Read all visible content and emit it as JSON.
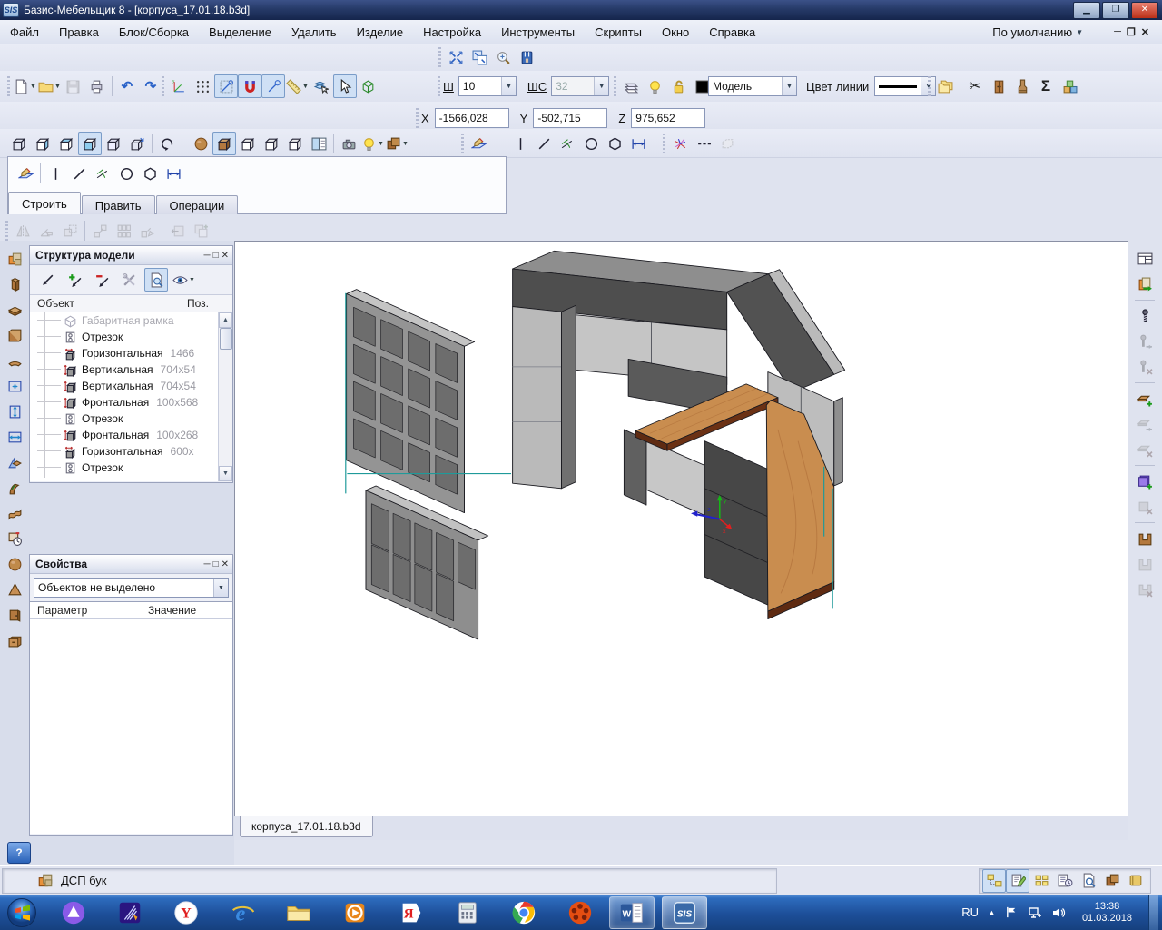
{
  "window": {
    "title": "Базис-Мебельщик 8 - [корпуса_17.01.18.b3d]",
    "logo": "SIS"
  },
  "menubar": {
    "items": [
      "Файл",
      "Правка",
      "Блок/Сборка",
      "Выделение",
      "Удалить",
      "Изделие",
      "Настройка",
      "Инструменты",
      "Скрипты",
      "Окно",
      "Справка"
    ],
    "profile": "По умолчанию"
  },
  "fields": {
    "sh_label": "Ш",
    "sh_value": "10",
    "shs_label": "ШС",
    "shs_value": "32",
    "model_value": "Модель",
    "line_color_label": "Цвет линии",
    "x_label": "X",
    "x_value": "-1566,028",
    "y_label": "Y",
    "y_value": "-502,715",
    "z_label": "Z",
    "z_value": "975,652"
  },
  "build_tabs": [
    {
      "label": "Строить",
      "active": true
    },
    {
      "label": "Править",
      "active": false
    },
    {
      "label": "Операции",
      "active": false
    }
  ],
  "structure_panel": {
    "title": "Структура модели",
    "columns": [
      "Объект",
      "Поз."
    ],
    "items": [
      {
        "kind": "frame",
        "label": "Габаритная рамка",
        "dim": "",
        "muted": true
      },
      {
        "kind": "segment",
        "label": "Отрезок",
        "dim": ""
      },
      {
        "kind": "panelh",
        "label": "Горизонтальная",
        "dim": "1466"
      },
      {
        "kind": "panelv",
        "label": "Вертикальная",
        "dim": "704x54"
      },
      {
        "kind": "panelv",
        "label": "Вертикальная",
        "dim": "704x54"
      },
      {
        "kind": "panelf",
        "label": "Фронтальная",
        "dim": "100x568"
      },
      {
        "kind": "segment",
        "label": "Отрезок",
        "dim": ""
      },
      {
        "kind": "panelf",
        "label": "Фронтальная",
        "dim": "100x268"
      },
      {
        "kind": "panelh",
        "label": "Горизонтальная",
        "dim": "600x"
      },
      {
        "kind": "segment",
        "label": "Отрезок",
        "dim": ""
      }
    ]
  },
  "properties_panel": {
    "title": "Свойства",
    "selection": "Объектов не выделено",
    "columns": [
      "Параметр",
      "Значение"
    ]
  },
  "document_tab": "корпуса_17.01.18.b3d",
  "status": {
    "material": "ДСП бук",
    "help": "?"
  },
  "taskbar": {
    "lang": "RU",
    "time": "13:38",
    "date": "01.03.2018",
    "apps": [
      {
        "name": "alice"
      },
      {
        "name": "pen-tool"
      },
      {
        "name": "yandex-browser"
      },
      {
        "name": "internet-explorer"
      },
      {
        "name": "file-explorer"
      },
      {
        "name": "media-player"
      },
      {
        "name": "yandex"
      },
      {
        "name": "calculator"
      },
      {
        "name": "chrome"
      },
      {
        "name": "movie-app"
      },
      {
        "name": "word",
        "active": true
      },
      {
        "name": "bazis",
        "active": true,
        "current": true
      }
    ]
  },
  "icons": {
    "zoom_tools": [
      {
        "name": "fit-screen",
        "kind": "fit"
      },
      {
        "name": "fit-all-windows",
        "kind": "fitall"
      },
      {
        "name": "zoom-lens",
        "kind": "lens"
      },
      {
        "name": "redraw-brush",
        "kind": "brushblk"
      }
    ],
    "file_tools": [
      {
        "name": "new-file",
        "kind": "doc",
        "arrow": true
      },
      {
        "name": "open-file",
        "kind": "folder",
        "arrow": true
      },
      {
        "name": "save-file",
        "kind": "floppy",
        "disabled": true
      },
      {
        "name": "print",
        "kind": "printer"
      },
      {
        "kind": "sep"
      },
      {
        "name": "undo",
        "kind": "undo"
      },
      {
        "name": "redo",
        "kind": "redo"
      }
    ],
    "snap_tools": [
      {
        "name": "coordinate-axes",
        "kind": "axes"
      },
      {
        "name": "grid",
        "kind": "griddots"
      },
      {
        "name": "snap-corner",
        "kind": "snapcorner",
        "pressed": true
      },
      {
        "name": "snap-magnet",
        "kind": "magnet",
        "pressed": true
      },
      {
        "name": "snap-line",
        "kind": "snapline",
        "pressed": true
      },
      {
        "name": "ruler",
        "kind": "ruler",
        "arrow": true
      },
      {
        "name": "select-layers",
        "kind": "layerscursor"
      },
      {
        "name": "select-cursor",
        "kind": "cursor",
        "pressed": true
      },
      {
        "name": "box-3d",
        "kind": "box3d"
      }
    ],
    "display_tools": [
      {
        "name": "layers",
        "kind": "layers"
      },
      {
        "name": "light-toggle",
        "kind": "bulb"
      },
      {
        "name": "lock-toggle",
        "kind": "lockopen"
      },
      {
        "name": "current-color",
        "kind": "swatchblack"
      }
    ],
    "object_tools": [
      {
        "name": "copy-objects",
        "kind": "foldercopy"
      },
      {
        "kind": "sep"
      },
      {
        "name": "cut-objects",
        "kind": "scissors"
      },
      {
        "name": "cabinet-tool",
        "kind": "cabinet"
      },
      {
        "name": "drill-tool",
        "kind": "drill"
      },
      {
        "name": "sum-tool",
        "kind": "sigma"
      },
      {
        "name": "assembly-blocks",
        "kind": "blocks"
      }
    ],
    "view_tools": [
      {
        "name": "view-wireframe",
        "kind": "cubewire"
      },
      {
        "name": "view-left",
        "kind": "cubeL"
      },
      {
        "name": "view-back",
        "kind": "cubeB"
      },
      {
        "name": "view-front",
        "kind": "cubeF",
        "pressed": true
      },
      {
        "name": "view-iso",
        "kind": "cubeI"
      },
      {
        "name": "view-rotate-to",
        "kind": "cubeA"
      },
      {
        "kind": "sep"
      },
      {
        "name": "rotate-view",
        "kind": "rotatearc"
      }
    ],
    "render_tools": [
      {
        "name": "render-sphere",
        "kind": "spherewood"
      },
      {
        "name": "render-textured",
        "kind": "cubewood",
        "pressed": true
      },
      {
        "name": "render-white-1",
        "kind": "cubewhite"
      },
      {
        "name": "render-white-2",
        "kind": "cubewhite"
      },
      {
        "name": "render-white-3",
        "kind": "cubewhite"
      },
      {
        "name": "split-view",
        "kind": "splitview"
      },
      {
        "kind": "sep"
      },
      {
        "name": "snapshot-camera",
        "kind": "camera"
      },
      {
        "name": "scene-light",
        "kind": "bulb",
        "arrow": true
      },
      {
        "name": "scene-materials",
        "kind": "cubesbrown",
        "arrow": true
      }
    ],
    "plane_tool": [
      {
        "name": "draw-on-plane",
        "kind": "drawplane"
      }
    ],
    "draw_tools": [
      {
        "name": "draw-vertical-line",
        "kind": "vline"
      },
      {
        "name": "draw-line",
        "kind": "dline"
      },
      {
        "name": "draw-parallel",
        "kind": "parallel"
      },
      {
        "name": "draw-circle",
        "kind": "circleicon"
      },
      {
        "name": "draw-polygon",
        "kind": "polygon"
      },
      {
        "name": "draw-dimension",
        "kind": "dimension"
      }
    ],
    "edit_tools": [
      {
        "name": "trim-burst",
        "kind": "burst"
      },
      {
        "name": "dashed-line",
        "kind": "dashed"
      },
      {
        "name": "ghost-box",
        "kind": "boxghost",
        "disabled": true
      }
    ],
    "modify_tools": [
      {
        "name": "mirror",
        "kind": "mirror",
        "disabled": true
      },
      {
        "name": "rotate-by-angle",
        "kind": "rotangle",
        "disabled": true
      },
      {
        "name": "scale",
        "kind": "scalecopy",
        "disabled": true
      },
      {
        "kind": "sep"
      },
      {
        "name": "copy-move",
        "kind": "copyup",
        "disabled": true
      },
      {
        "name": "copy-grid",
        "kind": "copygrid",
        "disabled": true
      },
      {
        "name": "copy-diagonal",
        "kind": "copydiag",
        "disabled": true
      },
      {
        "kind": "sep"
      },
      {
        "name": "paste-back",
        "kind": "pasteL",
        "disabled": true
      },
      {
        "name": "paste-add",
        "kind": "pastePlus",
        "disabled": true
      }
    ],
    "panel_draw_tools": [
      {
        "name": "draw-on-plane",
        "kind": "drawplane"
      },
      {
        "kind": "sep"
      },
      {
        "name": "draw-vertical-line",
        "kind": "vline"
      },
      {
        "name": "draw-line",
        "kind": "dline"
      },
      {
        "name": "draw-parallel",
        "kind": "parallel"
      },
      {
        "name": "draw-circle",
        "kind": "circleicon"
      },
      {
        "name": "draw-polygon",
        "kind": "polygon"
      },
      {
        "name": "draw-dimension",
        "kind": "dimension"
      }
    ],
    "left_tools": [
      {
        "name": "material-swatches",
        "kind": "matswatch"
      },
      {
        "name": "vertical-panel",
        "kind": "panelv"
      },
      {
        "name": "horizontal-panel",
        "kind": "panelh"
      },
      {
        "name": "frontal-panel",
        "kind": "panelf"
      },
      {
        "name": "curved-panel",
        "kind": "panelarc"
      },
      {
        "name": "frame-dimensions",
        "kind": "framearrows"
      },
      {
        "name": "vertical-dimension",
        "kind": "varrows"
      },
      {
        "name": "horizontal-dimension",
        "kind": "harrows"
      },
      {
        "name": "panel-on-plane",
        "kind": "panelplane"
      },
      {
        "name": "bent-panel",
        "kind": "panelbent"
      },
      {
        "name": "wavy-panel",
        "kind": "panelwavy"
      },
      {
        "name": "panel-rotation",
        "kind": "panelclock"
      },
      {
        "name": "sphere-solid",
        "kind": "spherewood"
      },
      {
        "name": "pyramid-solid",
        "kind": "cone"
      },
      {
        "name": "door-panel",
        "kind": "door"
      },
      {
        "name": "drawer-box",
        "kind": "drawer"
      }
    ],
    "right_tools": [
      {
        "name": "window-table",
        "kind": "wintable"
      },
      {
        "name": "material-transfer",
        "kind": "matarrow"
      },
      {
        "kind": "sep"
      },
      {
        "name": "screw-add",
        "kind": "screw"
      },
      {
        "name": "screw-move",
        "kind": "screwmove",
        "disabled": true
      },
      {
        "name": "screw-delete",
        "kind": "screwdel",
        "disabled": true
      },
      {
        "kind": "sep"
      },
      {
        "name": "edgeband-add",
        "kind": "bandadd"
      },
      {
        "name": "edgeband-move",
        "kind": "bandmove",
        "disabled": true
      },
      {
        "name": "edgeband-delete",
        "kind": "banddel",
        "disabled": true
      },
      {
        "kind": "sep"
      },
      {
        "name": "panel-add",
        "kind": "paneladd"
      },
      {
        "name": "panel-delete",
        "kind": "paneldel",
        "disabled": true
      },
      {
        "kind": "sep"
      },
      {
        "name": "groove-add",
        "kind": "groove"
      },
      {
        "name": "groove-move",
        "kind": "groove2",
        "disabled": true
      },
      {
        "name": "groove-delete",
        "kind": "groovedel",
        "disabled": true
      }
    ],
    "structure_tools": [
      {
        "name": "pick-object",
        "kind": "arrowline"
      },
      {
        "name": "add-to-selection",
        "kind": "addplus"
      },
      {
        "name": "remove-from-selection",
        "kind": "delminus"
      },
      {
        "name": "selection-settings",
        "kind": "tools"
      },
      {
        "name": "preview-object",
        "kind": "previewdoc",
        "pressed": true
      },
      {
        "name": "visibility",
        "kind": "eyedrop",
        "arrow": true
      }
    ],
    "status_tools": [
      {
        "name": "structure-view",
        "kind": "treenotes",
        "pressed": true
      },
      {
        "name": "edit-mode",
        "kind": "editpencil",
        "pressed": true
      },
      {
        "name": "cells-view",
        "kind": "cellsgrid"
      },
      {
        "name": "parameters-list",
        "kind": "listclock"
      },
      {
        "name": "search-preview",
        "kind": "searchdoc"
      },
      {
        "name": "material-blocks",
        "kind": "cubesbrown"
      },
      {
        "name": "materials-book",
        "kind": "book"
      }
    ]
  },
  "colors": {
    "wood": "#c98d4f",
    "cabinet_light": "#c2c2c2",
    "cabinet_dark": "#4a4a4a",
    "teal_guide": "#1f9a9a",
    "taskbar_blue": "#1d4f99",
    "title_bar": "#1c2c55"
  }
}
